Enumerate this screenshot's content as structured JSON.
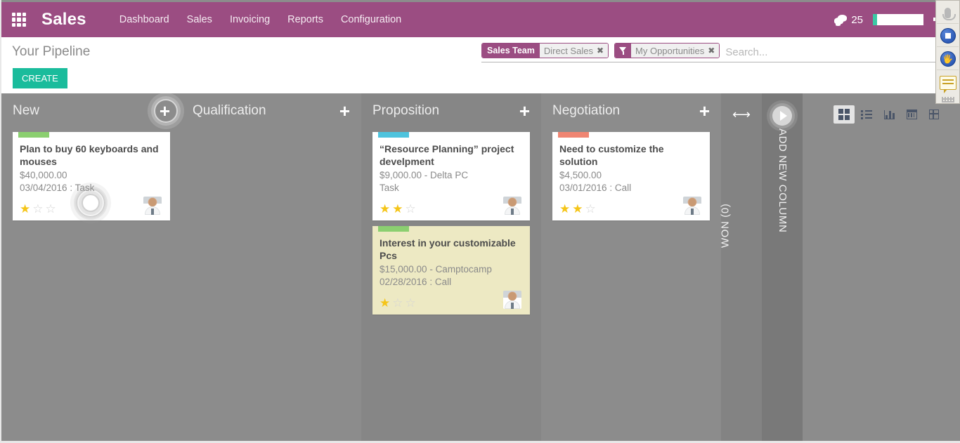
{
  "navbar": {
    "apps_icon": "apps-grid-icon",
    "brand": "Sales",
    "links": [
      {
        "label": "Dashboard"
      },
      {
        "label": "Sales"
      },
      {
        "label": "Invoicing"
      },
      {
        "label": "Reports"
      },
      {
        "label": "Configuration"
      }
    ],
    "messages_count": "25",
    "messages_icon": "chat-bubble-icon",
    "signout_icon": "sign-out-icon",
    "background_color": "#9b4d82"
  },
  "control_panel": {
    "page_title": "Your Pipeline",
    "create_label": "CREATE",
    "create_color": "#1abc9c",
    "search": {
      "placeholder": "Search...",
      "value": "",
      "facets": [
        {
          "category": "Sales Team",
          "value": "Direct Sales",
          "remove": "✖",
          "icon": ""
        },
        {
          "category": "",
          "value": "My Opportunities",
          "remove": "✖",
          "icon": "filter-funnel-icon"
        }
      ]
    },
    "views": [
      {
        "name": "kanban",
        "active": true
      },
      {
        "name": "list",
        "active": false
      },
      {
        "name": "graph",
        "active": false
      },
      {
        "name": "calendar",
        "active": false
      },
      {
        "name": "pivot",
        "active": false
      }
    ]
  },
  "kanban": {
    "columns": [
      {
        "title": "New",
        "add_icon": "plus-icon",
        "has_click_ripple": true,
        "cards": [
          {
            "bar_color": "#8bcf70",
            "title": "Plan to buy 60 keyboards and mouses",
            "amount": "$40,000.00",
            "meta": "03/04/2016 : Task",
            "stars": 1,
            "highlight": false,
            "avatar": "user-avatar",
            "has_click_ripple": true
          }
        ]
      },
      {
        "title": "Qualification",
        "add_icon": "plus-icon",
        "has_click_ripple": false,
        "cards": []
      },
      {
        "title": "Proposition",
        "add_icon": "plus-icon",
        "has_click_ripple": false,
        "cards": [
          {
            "bar_color": "#4ec3dd",
            "title": "“Resource Planning” project develpment",
            "amount": "$9,000.00 - Delta PC",
            "meta": "Task",
            "stars": 2,
            "highlight": false,
            "avatar": "user-avatar",
            "has_click_ripple": false
          },
          {
            "bar_color": "#8bcf70",
            "title": "Interest in your customizable Pcs",
            "amount": "$15,000.00 - Camptocamp",
            "meta": "02/28/2016 : Call",
            "stars": 1,
            "highlight": true,
            "avatar": "user-avatar",
            "has_click_ripple": false
          }
        ]
      },
      {
        "title": "Negotiation",
        "add_icon": "plus-icon",
        "has_click_ripple": false,
        "cards": [
          {
            "bar_color": "#ef8572",
            "title": "Need to customize the solution",
            "amount": "$4,500.00",
            "meta": "03/01/2016 : Call",
            "stars": 2,
            "highlight": false,
            "avatar": "user-avatar",
            "has_click_ripple": false
          }
        ]
      }
    ],
    "won_panel": {
      "icon": "horizontal-arrows-icon",
      "label": "WON (0)"
    },
    "add_column_panel": {
      "icon": "arrow-right-circle-icon",
      "label": "ADD NEW COLUMN"
    }
  },
  "recorder_toolbar": {
    "buttons": [
      {
        "name": "microphone-icon",
        "enabled": false
      },
      {
        "name": "stop-record-icon",
        "enabled": true
      },
      {
        "name": "hand-pointer-icon",
        "enabled": true
      },
      {
        "name": "annotation-icon",
        "enabled": true
      }
    ],
    "grip": "drag-handle-icon"
  }
}
